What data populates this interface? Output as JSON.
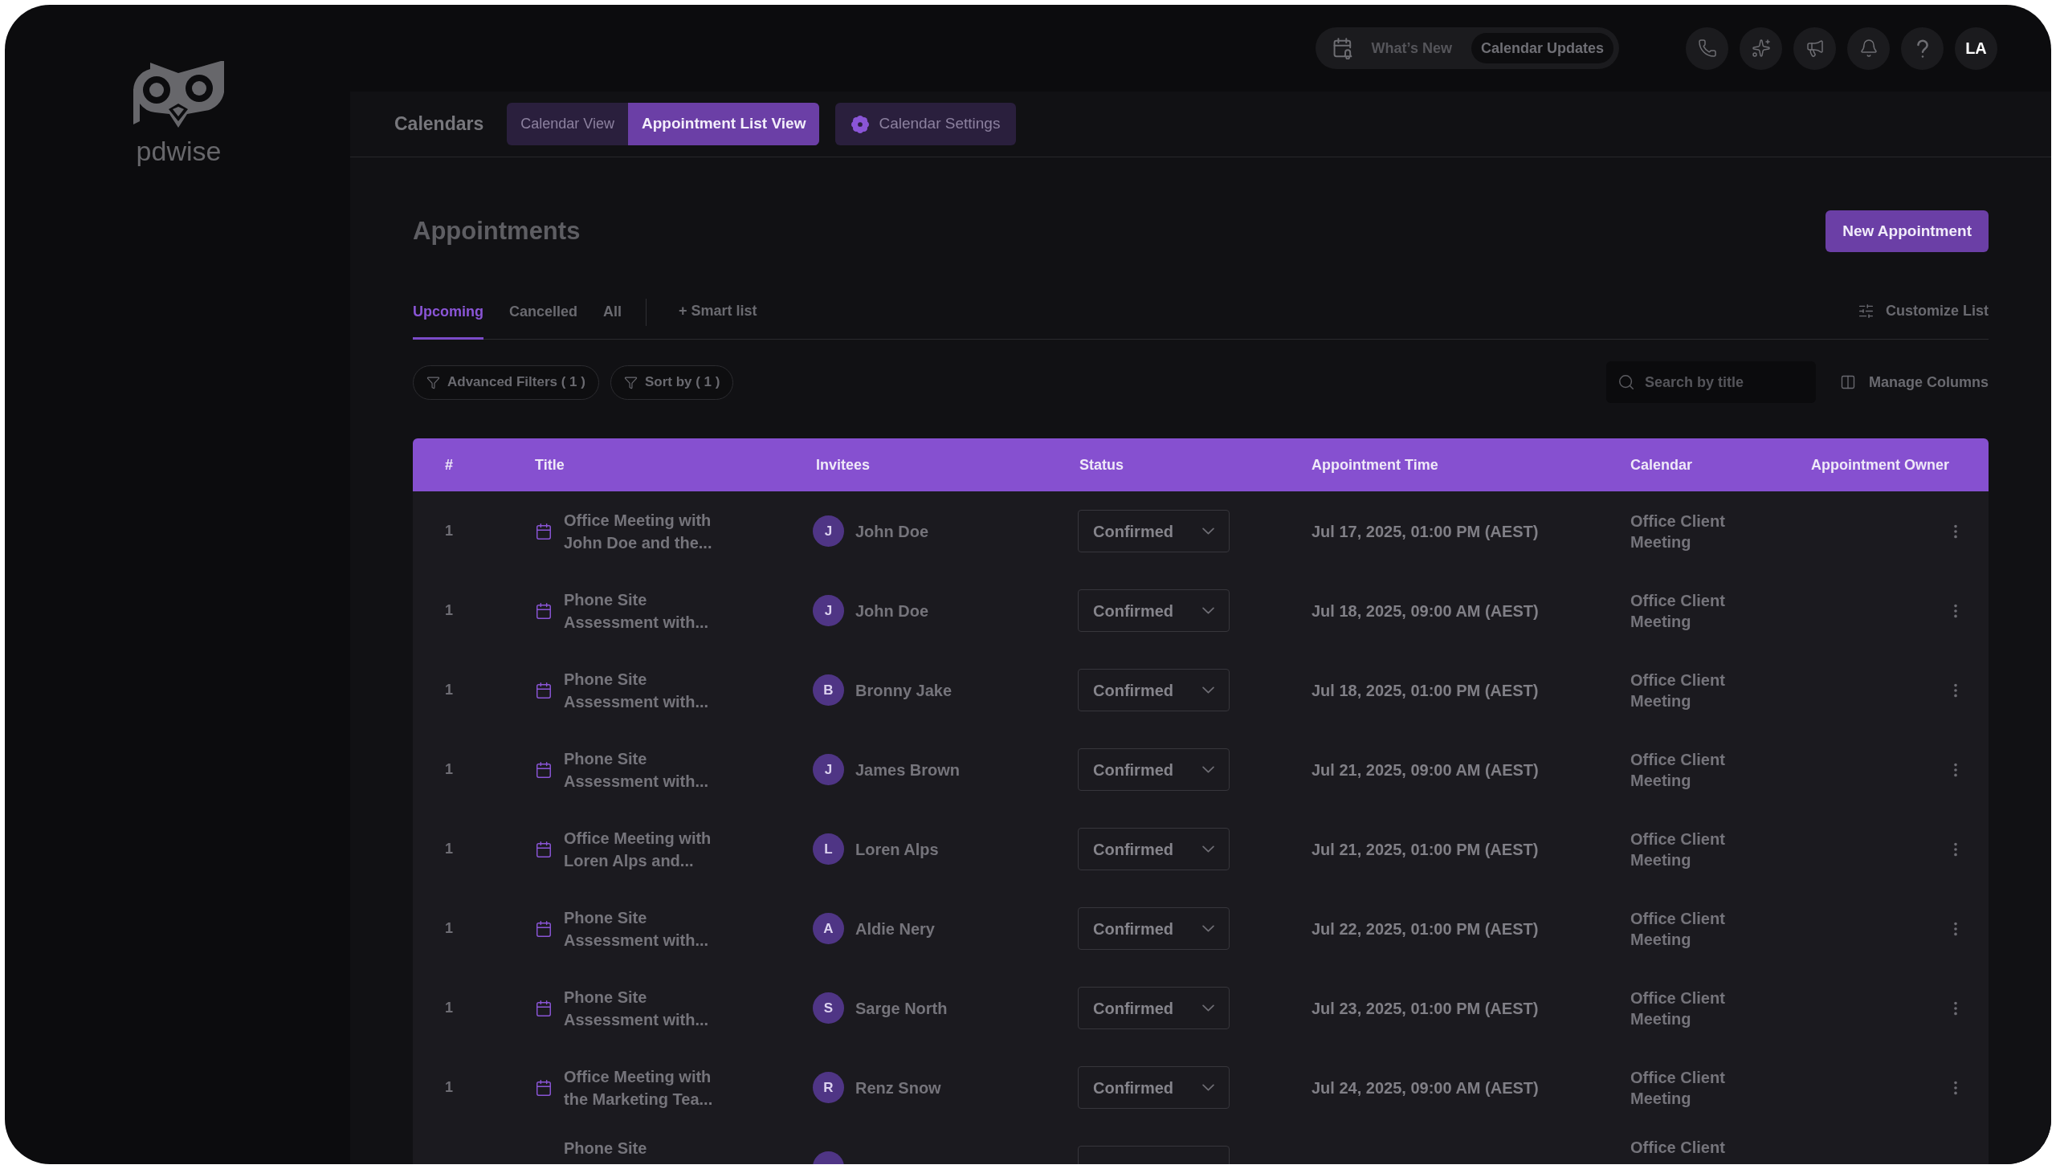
{
  "sidebar": {
    "logo_text": "pdwise"
  },
  "top_bar": {
    "updates_switch": [
      {
        "label": "What’s New",
        "selected": false
      },
      {
        "label": "Calendar Updates",
        "selected": true
      }
    ],
    "avatar_initials": "LA"
  },
  "sub_nav": {
    "title": "Calendars",
    "view_tabs": [
      {
        "label": "Calendar View",
        "selected": false
      },
      {
        "label": "Appointment List View",
        "selected": true
      }
    ],
    "settings_button": "Calendar Settings"
  },
  "page": {
    "title": "Appointments",
    "new_button": "New Appointment",
    "list_tabs": [
      {
        "label": "Upcoming",
        "selected": true
      },
      {
        "label": "Cancelled",
        "selected": false
      },
      {
        "label": "All",
        "selected": false
      }
    ],
    "smart_list": "+ Smart list",
    "customize_button": "Customize List",
    "filter_chips": [
      "Advanced Filters ( 1 )",
      "Sort by ( 1 )"
    ],
    "search": {
      "placeholder": "Search by title"
    },
    "manage_columns": "Manage Columns"
  },
  "table": {
    "columns": [
      "#",
      "Title",
      "Invitees",
      "Status",
      "Appointment Time",
      "Calendar",
      "Appointment Owner"
    ],
    "rows": [
      {
        "number": "1",
        "title": "Office Meeting with John Doe and the...",
        "invitee": {
          "initial": "J",
          "name": "John Doe"
        },
        "status": "Confirmed",
        "time": "Jul 17, 2025, 01:00 PM (AEST)",
        "calendar": "Office Client Meeting"
      },
      {
        "number": "1",
        "title": "Phone Site Assessment with...",
        "invitee": {
          "initial": "J",
          "name": "John Doe"
        },
        "status": "Confirmed",
        "time": "Jul 18, 2025, 09:00 AM (AEST)",
        "calendar": "Office Client Meeting"
      },
      {
        "number": "1",
        "title": "Phone Site Assessment with...",
        "invitee": {
          "initial": "B",
          "name": "Bronny Jake"
        },
        "status": "Confirmed",
        "time": "Jul 18, 2025, 01:00 PM (AEST)",
        "calendar": "Office Client Meeting"
      },
      {
        "number": "1",
        "title": "Phone Site Assessment with...",
        "invitee": {
          "initial": "J",
          "name": "James Brown"
        },
        "status": "Confirmed",
        "time": "Jul 21, 2025, 09:00 AM (AEST)",
        "calendar": "Office Client Meeting"
      },
      {
        "number": "1",
        "title": "Office Meeting with Loren Alps and...",
        "invitee": {
          "initial": "L",
          "name": "Loren Alps"
        },
        "status": "Confirmed",
        "time": "Jul 21, 2025, 01:00 PM (AEST)",
        "calendar": "Office Client Meeting"
      },
      {
        "number": "1",
        "title": "Phone Site Assessment with...",
        "invitee": {
          "initial": "A",
          "name": "Aldie Nery"
        },
        "status": "Confirmed",
        "time": "Jul 22, 2025, 01:00 PM (AEST)",
        "calendar": "Office Client Meeting"
      },
      {
        "number": "1",
        "title": "Phone Site Assessment with...",
        "invitee": {
          "initial": "S",
          "name": "Sarge North"
        },
        "status": "Confirmed",
        "time": "Jul 23, 2025, 01:00 PM (AEST)",
        "calendar": "Office Client Meeting"
      },
      {
        "number": "1",
        "title": "Office Meeting with the Marketing Tea...",
        "invitee": {
          "initial": "R",
          "name": "Renz Snow"
        },
        "status": "Confirmed",
        "time": "Jul 24, 2025, 09:00 AM (AEST)",
        "calendar": "Office Client Meeting"
      },
      {
        "title": "Phone Site",
        "calendar": "Office Client"
      }
    ]
  }
}
